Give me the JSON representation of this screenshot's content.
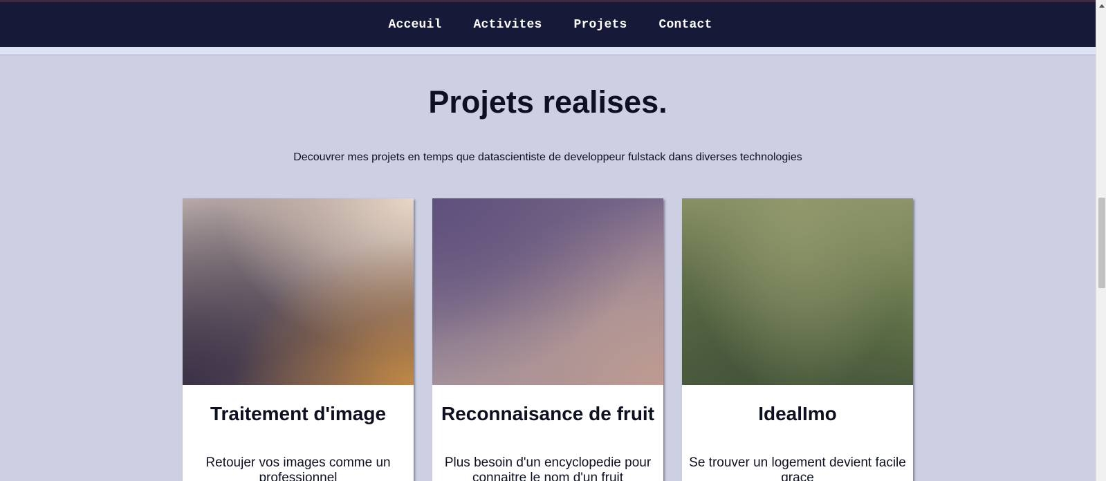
{
  "nav": {
    "items": [
      "Acceuil",
      "Activites",
      "Projets",
      "Contact"
    ]
  },
  "section": {
    "title": "Projets realises.",
    "subtitle": "Decouvrer mes projets en temps que datascientiste de developpeur fulstack dans diverses technologies"
  },
  "projects": [
    {
      "title": "Traitement d'image",
      "description": "Retoujer vos images comme un professionnel"
    },
    {
      "title": "Reconnaisance de fruit",
      "description": "Plus besoin d'un encyclopedie pour connaitre le nom d'un fruit"
    },
    {
      "title": "IdealImo",
      "description": "Se trouver un logement devient facile grace"
    }
  ],
  "colors": {
    "navbar": "#161a38",
    "background": "#ccd0e2",
    "text": "#0c1021"
  }
}
